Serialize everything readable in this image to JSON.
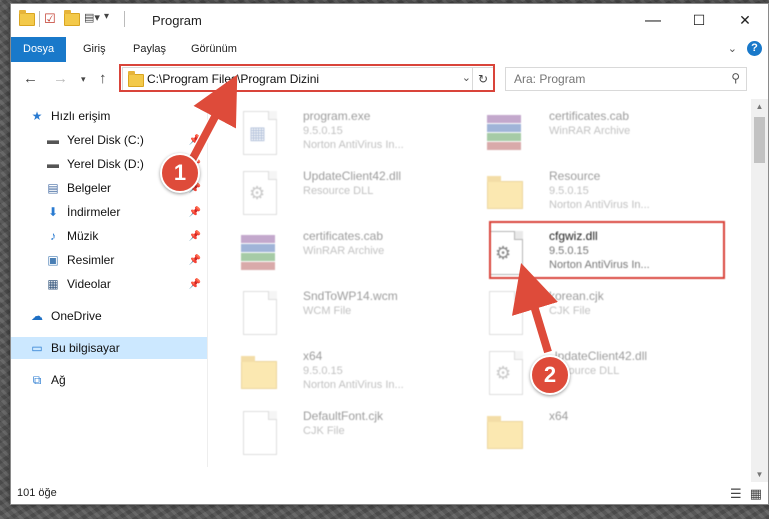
{
  "window": {
    "title": "Program",
    "controls": {
      "minimize": "—",
      "maximize": "☐",
      "close": "✕"
    }
  },
  "ribbon": {
    "tabs": [
      "Dosya",
      "Giriş",
      "Paylaş",
      "Görünüm"
    ],
    "help": "?"
  },
  "address": {
    "path": "C:\\Program Files\\Program Dizini",
    "search_placeholder": "Ara: Program"
  },
  "nav": {
    "items": [
      {
        "label": "Hızlı erişim",
        "icon": "star-icon"
      },
      {
        "label": "Yerel Disk (C:)",
        "icon": "drive-icon"
      },
      {
        "label": "Yerel Disk (D:)",
        "icon": "drive-icon"
      },
      {
        "label": "Belgeler",
        "icon": "documents-icon"
      },
      {
        "label": "İndirmeler",
        "icon": "download-icon"
      },
      {
        "label": "Müzik",
        "icon": "music-icon"
      },
      {
        "label": "Resimler",
        "icon": "pictures-icon"
      },
      {
        "label": "Videolar",
        "icon": "video-icon"
      },
      {
        "label": "OneDrive",
        "icon": "cloud-icon"
      },
      {
        "label": "Bu bilgisayar",
        "icon": "computer-icon"
      },
      {
        "label": "Ağ",
        "icon": "network-icon"
      }
    ]
  },
  "files": [
    {
      "name": "program.exe",
      "line2": "9.5.0.15",
      "line3": "Norton AntiVirus In...",
      "kind": "exe"
    },
    {
      "name": "certificates.cab",
      "line2": "WinRAR Archive",
      "line3": "",
      "kind": "rar"
    },
    {
      "name": "UpdateClient42.dll",
      "line2": "Resource DLL",
      "line3": "",
      "kind": "dll"
    },
    {
      "name": "Resource",
      "line2": "9.5.0.15",
      "line3": "Norton AntiVirus In...",
      "kind": "folder"
    },
    {
      "name": "certificates.cab",
      "line2": "WinRAR Archive",
      "line3": "",
      "kind": "rar"
    },
    {
      "name": "cfgwiz.dll",
      "line2": "9.5.0.15",
      "line3": "Norton AntiVirus In...",
      "kind": "dll"
    },
    {
      "name": "SndToWP14.wcm",
      "line2": "WCM File",
      "line3": "",
      "kind": "doc"
    },
    {
      "name": "korean.cjk",
      "line2": "CJK File",
      "line3": "",
      "kind": "doc"
    },
    {
      "name": "x64",
      "line2": "9.5.0.15",
      "line3": "Norton AntiVirus In...",
      "kind": "folder"
    },
    {
      "name": "UpdateClient42.dll",
      "line2": "Resource DLL",
      "line3": "",
      "kind": "dll"
    },
    {
      "name": "DefaultFont.cjk",
      "line2": "CJK File",
      "line3": "",
      "kind": "doc"
    },
    {
      "name": "x64",
      "line2": "",
      "line3": "",
      "kind": "folder"
    }
  ],
  "status": {
    "count": "101 öğe"
  },
  "callouts": {
    "one": "1",
    "two": "2"
  },
  "colors": {
    "accent": "#1979ca",
    "highlight": "#d9443a",
    "selected_nav": "#cce8ff"
  }
}
